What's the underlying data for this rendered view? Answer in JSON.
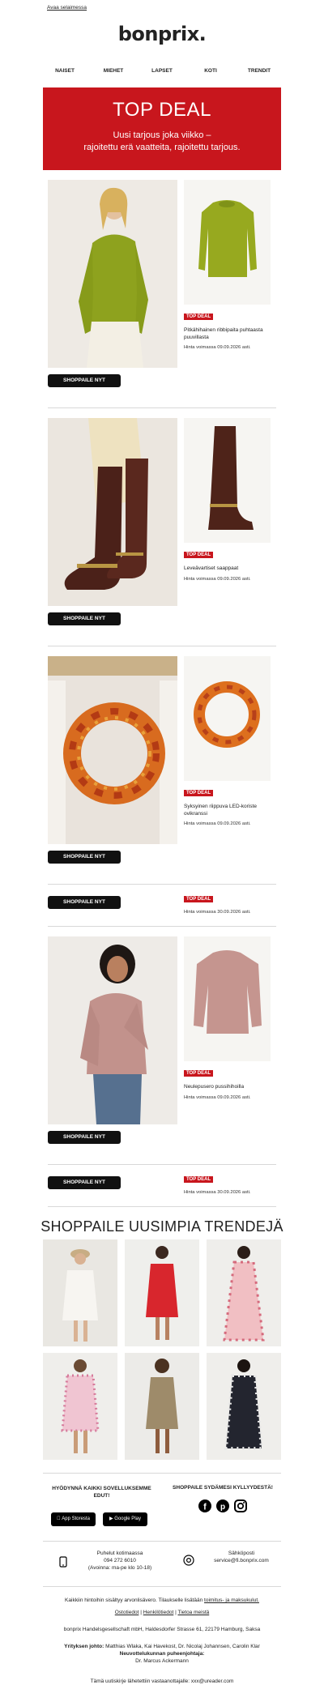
{
  "topbar": {
    "browser_link": "Avaa selaimessa"
  },
  "logo": "bonprix.",
  "nav": [
    "NAISET",
    "MIEHET",
    "LAPSET",
    "KOTI",
    "TRENDIT"
  ],
  "hero": {
    "title": "TOP DEAL",
    "line1": "Uusi tarjous joka viikko –",
    "line2": "rajoitettu erä vaatteita, rajoitettu tarjous."
  },
  "products": [
    {
      "badge": "TOP DEAL",
      "name": "Pitkähihainen ribbipaita puhtaasta puuvillasta",
      "valid": "Hinta voimassa 09.09.2026 asti.",
      "button": "SHOPPAILE NYT"
    },
    {
      "badge": "TOP DEAL",
      "name": "Leveävartiset saappaat",
      "valid": "Hinta voimassa 09.09.2026 asti.",
      "button": "SHOPPAILE NYT"
    },
    {
      "badge": "TOP DEAL",
      "name": "Syksyinen riippuva LED-koriste ovikranssi",
      "valid": "Hinta voimassa 09.09.2026 asti.",
      "button": "SHOPPAILE NYT"
    },
    {
      "badge": "TOP DEAL",
      "name": "",
      "valid": "Hinta voimassa 30.09.2026 asti.",
      "button": "SHOPPAILE NYT"
    },
    {
      "badge": "TOP DEAL",
      "name": "Neulepusero pussihihoilla",
      "valid": "Hinta voimassa 09.09.2026 asti.",
      "button": "SHOPPAILE NYT"
    },
    {
      "badge": "TOP DEAL",
      "name": "",
      "valid": "Hinta voimassa 30.09.2026 asti.",
      "button": "SHOPPAILE NYT"
    }
  ],
  "trends": {
    "title": "SHOPPAILE UUSIMPIA TRENDEJÄ"
  },
  "app": {
    "heading_line1": "HYÖDYNNÄ KAIKKI SOVELLUKSEMME",
    "heading_line2": "EDUT!",
    "appstore": "App Storesta",
    "googleplay": "Google Play"
  },
  "social": {
    "heading": "SHOPPAILE SYDÄMESI KYLLYYDESTÄ!"
  },
  "contact": {
    "phone_label": "Puhelut kotimaassa",
    "phone": "094 272 6010",
    "hours": "(Avoinna: ma-pe klo 10-18)",
    "email_label": "Sähköposti",
    "email": "service@fi.bonprix.com"
  },
  "legal": {
    "vat_text": "Kaikkiin hintoihin sisältyy arvonlisävero. Tilaukselle lisätään ",
    "vat_link": "toimitus- ja maksukulut.",
    "links": [
      "Ostotiedot",
      "Henkilötiedot",
      "Tietoa meistä"
    ],
    "address": "bonprix Handelsgesellschaft mbH, Haldesdorfer Strasse 61, 22179 Hamburg, Saksa",
    "mgmt_label": "Yrityksen johto:",
    "mgmt_names": "Matthias Wlaka, Kai Havekost, Dr. Nicolaj Johannsen, Carolin Klar",
    "board_label": "Neuvottelukunnan puheenjohtaja:",
    "board_name": "Dr. Marcus Ackermann",
    "recipient": "Tämä uutiskirje lähetettiin vastaanottajalle: xxx@ureader.com"
  }
}
